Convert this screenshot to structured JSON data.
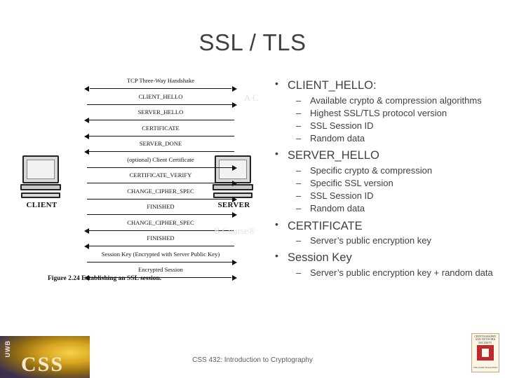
{
  "slide": {
    "title": "SSL / TLS",
    "footer": "CSS 432: Introduction to Cryptography"
  },
  "figure": {
    "caption": "Figure 2.24  Establishing an SSL session.",
    "client_label": "CLIENT",
    "server_label": "SERVER",
    "messages": [
      {
        "label": "TCP Three-Way Handshake",
        "direction": "both"
      },
      {
        "label": "CLIENT_HELLO",
        "direction": "right"
      },
      {
        "label": "SERVER_HELLO",
        "direction": "left"
      },
      {
        "label": "CERTIFICATE",
        "direction": "left"
      },
      {
        "label": "SERVER_DONE",
        "direction": "left"
      },
      {
        "label": "(optional) Client Certificate",
        "direction": "right"
      },
      {
        "label": "CERTIFICATE_VERIFY",
        "direction": "right"
      },
      {
        "label": "CHANGE_CIPHER_SPEC",
        "direction": "right"
      },
      {
        "label": "FINISHED",
        "direction": "right"
      },
      {
        "label": "CHANGE_CIPHER_SPEC",
        "direction": "left"
      },
      {
        "label": "FINISHED",
        "direction": "left"
      },
      {
        "label": "Session Key (Encrypted with Server Public Key)",
        "direction": "right"
      },
      {
        "label": "Encrypted Session",
        "direction": "both"
      }
    ]
  },
  "ghost": {
    "top_right": "A C",
    "middle": "B Course®"
  },
  "content": {
    "sections": [
      {
        "heading": "CLIENT_HELLO:",
        "items": [
          "Available crypto & compression algorithms",
          "Highest SSL/TLS protocol version",
          "SSL Session ID",
          "Random data"
        ]
      },
      {
        "heading": "SERVER_HELLO",
        "items": [
          "Specific crypto & compression",
          "Specific SSL version",
          "SSL Session ID",
          "Random data"
        ]
      },
      {
        "heading": "CERTIFICATE",
        "items": [
          "Server’s public encryption key"
        ]
      },
      {
        "heading": "Session Key",
        "items": [
          "Server’s public encryption key + random data"
        ]
      }
    ]
  },
  "logos": {
    "css_mark": "CSS",
    "uwb_mark": "UWB",
    "book_title": "CRYPTOGRAPHY AND NETWORK SECURITY",
    "book_sub": "WILLIAM STALLINGS"
  }
}
